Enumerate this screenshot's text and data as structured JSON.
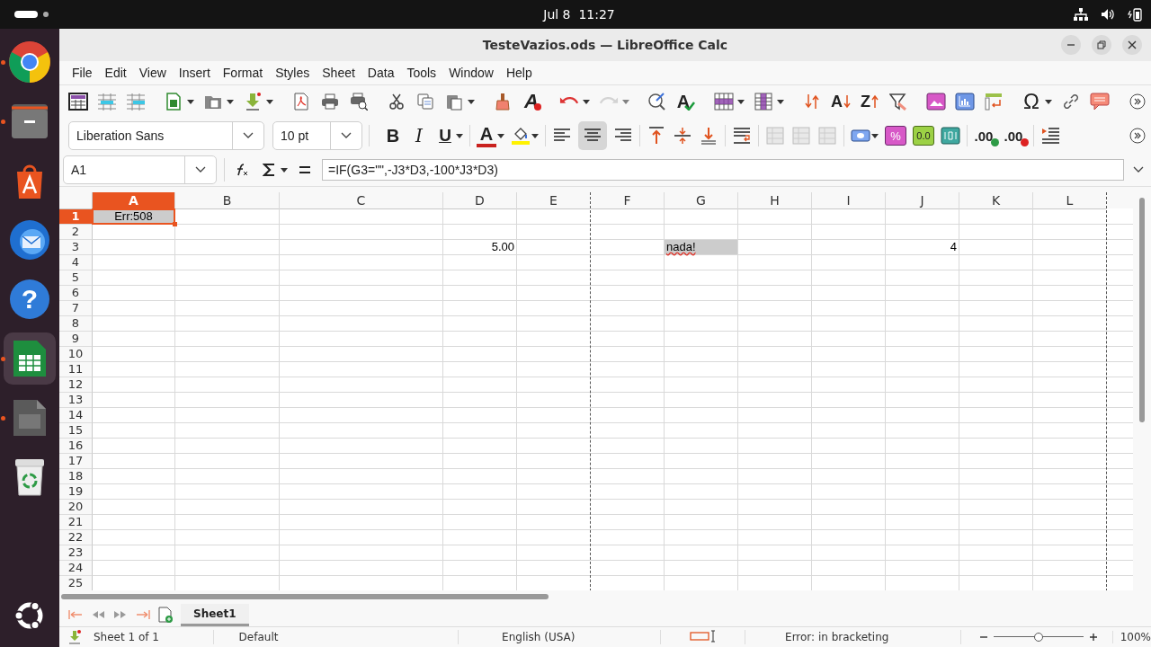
{
  "top_bar": {
    "clock": "Jul 8  11:27"
  },
  "dock": [
    {
      "kind": "browser",
      "running": true,
      "selected": false
    },
    {
      "kind": "files",
      "running": true,
      "selected": false
    },
    {
      "kind": "app-center",
      "running": false,
      "selected": false
    },
    {
      "kind": "mail",
      "running": false,
      "selected": false
    },
    {
      "kind": "help",
      "glyph": "?",
      "running": false,
      "selected": false
    },
    {
      "kind": "calc",
      "running": true,
      "selected": true
    },
    {
      "kind": "impress",
      "running": true,
      "selected": false
    },
    {
      "kind": "trash",
      "running": false,
      "selected": false
    },
    {
      "kind": "show-apps",
      "running": false,
      "selected": false
    }
  ],
  "window": {
    "title": "TesteVazios.ods — LibreOffice Calc"
  },
  "menu": [
    "File",
    "Edit",
    "View",
    "Insert",
    "Format",
    "Styles",
    "Sheet",
    "Data",
    "Tools",
    "Window",
    "Help"
  ],
  "standard_toolbar": {
    "clear_formatting": "A",
    "spelling": "A",
    "sort_ascending": "A",
    "sort_descending": "Z",
    "special_character": "Ω"
  },
  "formatting_toolbar": {
    "font_name": "Liberation Sans",
    "font_size": "10 pt",
    "bold": "B",
    "italic": "I",
    "underline": "U",
    "font_color": "A",
    "align_center_selected": true,
    "percent": "%",
    "number": "0.0",
    "add_decimal": ".00",
    "delete_decimal": ".00"
  },
  "formula_bar": {
    "cell_reference": "A1",
    "formula": "=IF(G3=\"\",-J3*D3,-100*J3*D3)"
  },
  "sheet": {
    "columns": [
      {
        "label": "A",
        "selected": true,
        "page_break_after": false
      },
      {
        "label": "B",
        "selected": false,
        "page_break_after": false
      },
      {
        "label": "C",
        "selected": false,
        "page_break_after": false
      },
      {
        "label": "D",
        "selected": false,
        "page_break_after": false
      },
      {
        "label": "E",
        "selected": false,
        "page_break_after": true
      },
      {
        "label": "F",
        "selected": false,
        "page_break_after": false
      },
      {
        "label": "G",
        "selected": false,
        "page_break_after": false
      },
      {
        "label": "H",
        "selected": false,
        "page_break_after": false
      },
      {
        "label": "I",
        "selected": false,
        "page_break_after": false
      },
      {
        "label": "J",
        "selected": false,
        "page_break_after": false
      },
      {
        "label": "K",
        "selected": false,
        "page_break_after": false
      },
      {
        "label": "L",
        "selected": false,
        "page_break_after": true
      }
    ],
    "rows": [
      {
        "label": "1",
        "selected": true,
        "cells": [
          {
            "text": "Err:508",
            "kind": "error",
            "highlighted": true,
            "misspelled": false,
            "cursor": true
          }
        ]
      },
      {
        "label": "2",
        "selected": false
      },
      {
        "label": "3",
        "selected": false,
        "cells": [
          null,
          null,
          null,
          {
            "text": "5.00",
            "kind": "number",
            "highlighted": false,
            "misspelled": false,
            "cursor": false
          },
          null,
          null,
          {
            "text": "nada!",
            "kind": "text",
            "highlighted": true,
            "misspelled": true,
            "cursor": false
          },
          null,
          null,
          {
            "text": "4",
            "kind": "number",
            "highlighted": false,
            "misspelled": false,
            "cursor": false
          }
        ]
      },
      {
        "label": "4",
        "selected": false
      },
      {
        "label": "5",
        "selected": false
      },
      {
        "label": "6",
        "selected": false
      },
      {
        "label": "7",
        "selected": false
      },
      {
        "label": "8",
        "selected": false
      },
      {
        "label": "9",
        "selected": false
      },
      {
        "label": "10",
        "selected": false
      },
      {
        "label": "11",
        "selected": false
      },
      {
        "label": "12",
        "selected": false
      },
      {
        "label": "13",
        "selected": false
      },
      {
        "label": "14",
        "selected": false
      },
      {
        "label": "15",
        "selected": false
      },
      {
        "label": "16",
        "selected": false
      },
      {
        "label": "17",
        "selected": false
      },
      {
        "label": "18",
        "selected": false
      },
      {
        "label": "19",
        "selected": false
      },
      {
        "label": "20",
        "selected": false
      },
      {
        "label": "21",
        "selected": false
      },
      {
        "label": "22",
        "selected": false
      },
      {
        "label": "23",
        "selected": false
      },
      {
        "label": "24",
        "selected": false
      },
      {
        "label": "25",
        "selected": false
      }
    ]
  },
  "sheet_tabs": [
    {
      "label": "Sheet1",
      "selected": true
    }
  ],
  "status_bar": {
    "sheet": "Sheet 1 of 1",
    "page_style": "Default",
    "language": "English (USA)",
    "message": "Error: in bracketing",
    "zoom": {
      "level": 0.5
    },
    "zoom_value": "100%"
  }
}
